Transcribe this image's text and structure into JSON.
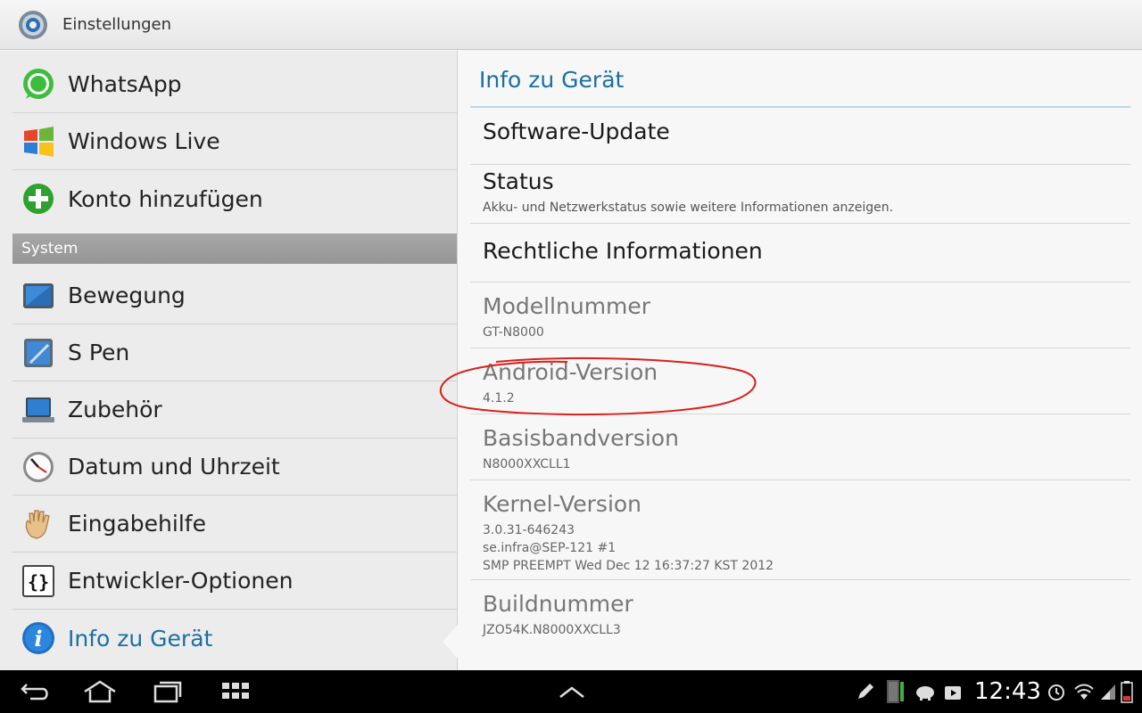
{
  "titlebar": {
    "title": "Einstellungen",
    "icon": "settings-gear-icon"
  },
  "left": {
    "accounts": [
      {
        "label": "WhatsApp",
        "icon": "whatsapp-icon"
      },
      {
        "label": "Windows Live",
        "icon": "windows-live-icon"
      },
      {
        "label": "Konto hinzufügen",
        "icon": "add-account-icon"
      }
    ],
    "section": "System",
    "system": [
      {
        "label": "Bewegung",
        "icon": "motion-icon"
      },
      {
        "label": "S Pen",
        "icon": "s-pen-icon"
      },
      {
        "label": "Zubehör",
        "icon": "accessory-icon"
      },
      {
        "label": "Datum und Uhrzeit",
        "icon": "clock-icon"
      },
      {
        "label": "Eingabehilfe",
        "icon": "hand-icon"
      },
      {
        "label": "Entwickler-Optionen",
        "icon": "developer-braces-icon"
      },
      {
        "label": "Info zu Gerät",
        "icon": "info-icon"
      }
    ]
  },
  "right": {
    "header": "Info zu Gerät",
    "items": [
      {
        "title": "Software-Update"
      },
      {
        "title": "Status",
        "sub": "Akku- und Netzwerkstatus sowie weitere Informationen anzeigen."
      },
      {
        "title": "Rechtliche Informationen"
      },
      {
        "title": "Modellnummer",
        "sub": "GT-N8000"
      },
      {
        "title": "Android-Version",
        "sub": "4.1.2"
      },
      {
        "title": "Basisbandversion",
        "sub": "N8000XXCLL1"
      },
      {
        "title": "Kernel-Version",
        "sub1": "3.0.31-646243",
        "sub2": "se.infra@SEP-121 #1",
        "sub3": "SMP PREEMPT Wed Dec 12 16:37:27 KST 2012"
      },
      {
        "title": "Buildnummer",
        "sub": "JZO54K.N8000XXCLL3"
      }
    ]
  },
  "statusbar": {
    "time": "12:43"
  },
  "colors": {
    "accent": "#1a6fa3",
    "annotation": "#d8201c"
  }
}
